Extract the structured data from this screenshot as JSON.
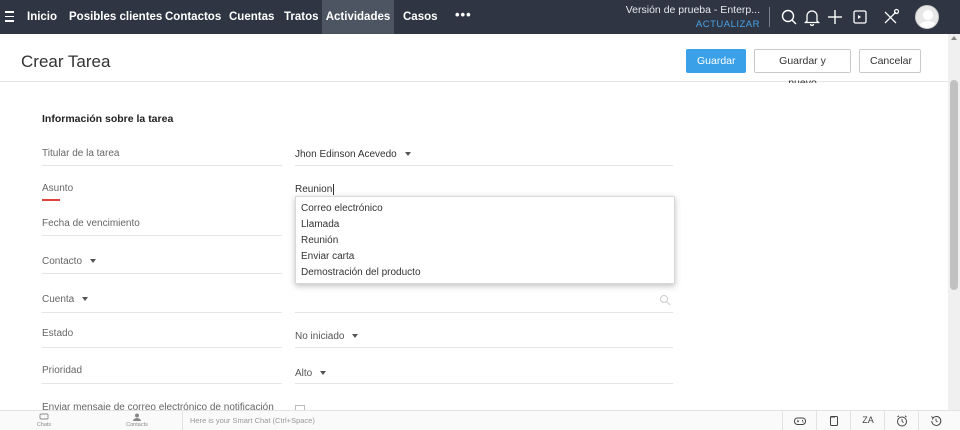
{
  "nav": {
    "items": [
      {
        "label": "Inicio",
        "active": false
      },
      {
        "label": "Posibles clientes",
        "active": false
      },
      {
        "label": "Contactos",
        "active": false
      },
      {
        "label": "Cuentas",
        "active": false
      },
      {
        "label": "Tratos",
        "active": false
      },
      {
        "label": "Actividades",
        "active": true
      },
      {
        "label": "Casos",
        "active": false
      }
    ],
    "more": "•••",
    "trial_text": "Versión de prueba - Enterp...",
    "upgrade_text": "ACTUALIZAR",
    "icons": [
      "search-icon",
      "bell-icon",
      "plus-icon",
      "calendar-icon",
      "tools-icon"
    ]
  },
  "header": {
    "title": "Crear Tarea",
    "save": "Guardar",
    "save_new": "Guardar y nuevo",
    "cancel": "Cancelar"
  },
  "form": {
    "section_title": "Información sobre la tarea",
    "owner_label": "Titular de la tarea",
    "owner_value": "Jhon Edinson Acevedo",
    "subject_label": "Asunto",
    "subject_value": "Reunion",
    "due_label": "Fecha de vencimiento",
    "contact_label": "Contacto",
    "account_label": "Cuenta",
    "status_label": "Estado",
    "status_value": "No iniciado",
    "priority_label": "Prioridad",
    "priority_value": "Alto",
    "notify_label": "Enviar mensaje de correo electrónico de notificación"
  },
  "subject_suggestions": [
    "Correo electrónico",
    "Llamada",
    "Reunión",
    "Enviar carta",
    "Demostración del producto"
  ],
  "bottombar": {
    "chats": "Chats",
    "contacts": "Contacts",
    "smart_chat": "Here is your Smart Chat (Ctrl+Space)",
    "translate": "ZA"
  },
  "colors": {
    "nav_bg": "#2f3542",
    "nav_active": "#4d5462",
    "primary": "#3aa1e8",
    "required": "#e0443a",
    "upgrade": "#4aa3e6"
  }
}
